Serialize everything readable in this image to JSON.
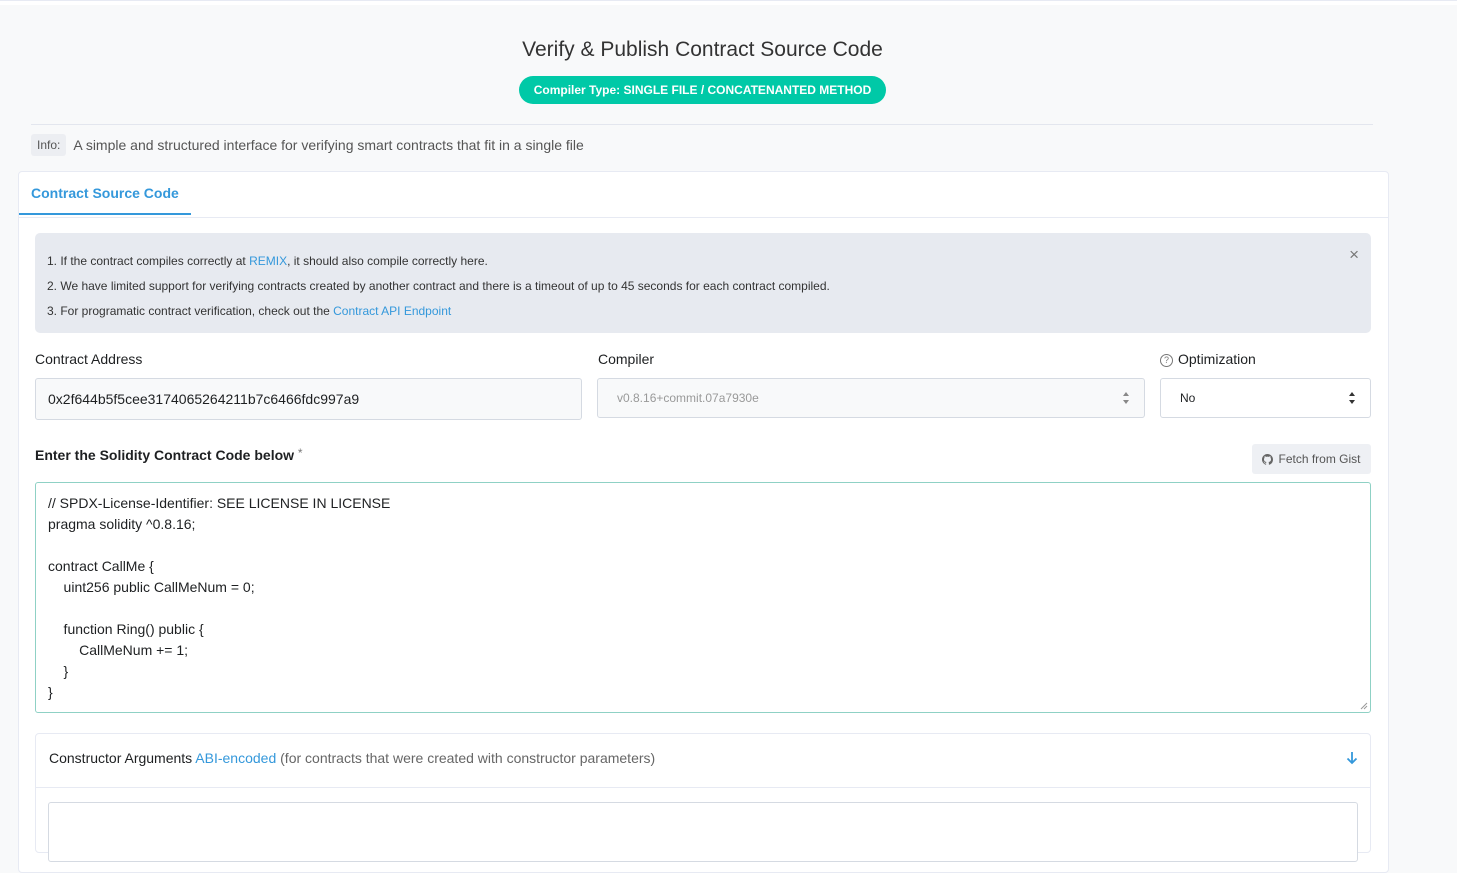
{
  "header": {
    "title": "Verify & Publish Contract Source Code",
    "compiler_badge": "Compiler Type: SINGLE FILE / CONCATENANTED METHOD",
    "info_label": "Info:",
    "info_text": "A simple and structured interface for verifying smart contracts that fit in a single file"
  },
  "tabs": [
    {
      "label": "Contract Source Code",
      "active": true
    }
  ],
  "notice": {
    "line1_prefix": "1. If the contract compiles correctly at ",
    "line1_link": "REMIX",
    "line1_suffix": ", it should also compile correctly here.",
    "line2": "2. We have limited support for verifying contracts created by another contract and there is a timeout of up to 45 seconds for each contract compiled.",
    "line3_prefix": "3. For programatic contract verification, check out the ",
    "line3_link": "Contract API Endpoint",
    "close_glyph": "×"
  },
  "form": {
    "contract_address_label": "Contract Address",
    "contract_address_value": "0x2f644b5f5cee3174065264211b7c6466fdc997a9",
    "compiler_label": "Compiler",
    "compiler_value": "v0.8.16+commit.07a7930e",
    "optimization_label": "Optimization",
    "optimization_help": "?",
    "optimization_value": "No"
  },
  "code": {
    "label": "Enter the Solidity Contract Code below",
    "required_mark": "*",
    "fetch_gist_label": "Fetch from Gist",
    "source": "// SPDX-License-Identifier: SEE LICENSE IN LICENSE\npragma solidity ^0.8.16;\n\ncontract CallMe {\n    uint256 public CallMeNum = 0;\n\n    function Ring() public {\n        CallMeNum += 1;\n    }\n}"
  },
  "constructor_args": {
    "title": "Constructor Arguments",
    "link": "ABI-encoded",
    "note": "(for contracts that were created with constructor parameters)"
  },
  "colors": {
    "accent": "#3498db",
    "badge": "#00c9a7"
  }
}
